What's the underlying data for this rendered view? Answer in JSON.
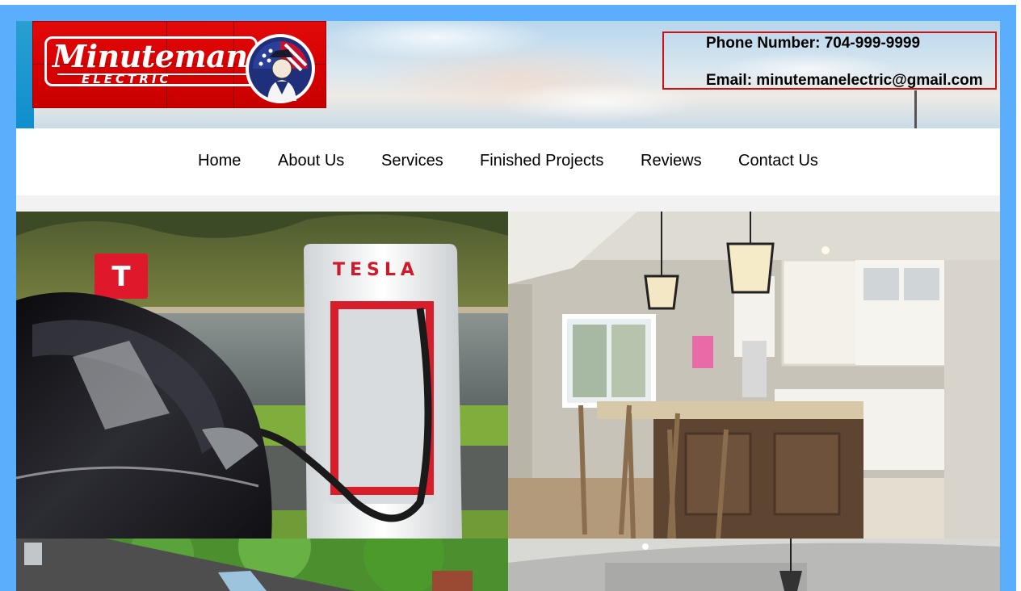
{
  "logo": {
    "title": "Minuteman",
    "subtitle": "ELECTRIC"
  },
  "contact": {
    "phone": "Phone Number: 704-999-9999",
    "email": "Email: minutemanelectric@gmail.com"
  },
  "nav": {
    "items": [
      "Home",
      "About Us",
      "Services",
      "Finished Projects",
      "Reviews",
      "Contact Us"
    ]
  },
  "gallery": {
    "tesla_charger_text": "TESLA",
    "tiles": [
      "ev-charging-photo",
      "kitchen-photo",
      "roof-photo",
      "interior-ceiling-photo"
    ]
  },
  "colors": {
    "frame": "#5aaefc",
    "logo_red": "#d80000",
    "contact_border": "#d01010",
    "nav_text": "#000000"
  }
}
